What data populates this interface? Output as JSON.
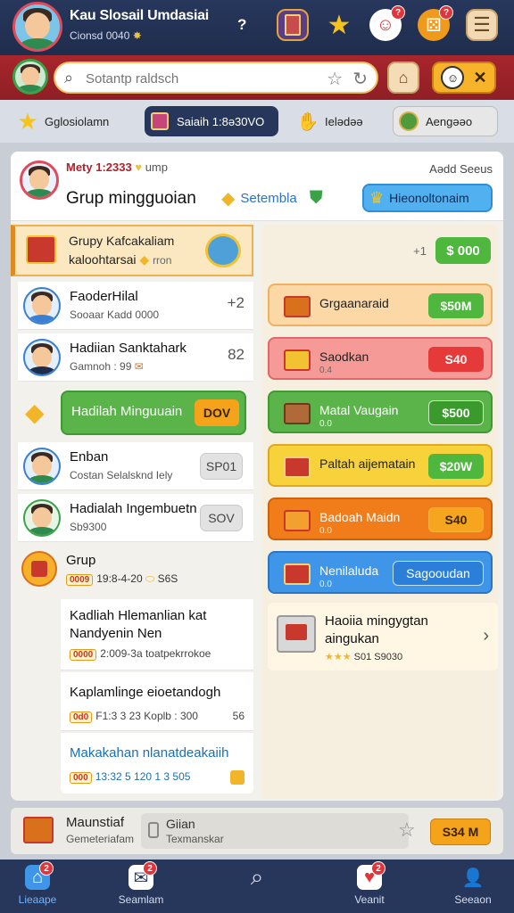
{
  "header": {
    "title": "Kau Slosail Umdasiai",
    "subtitle": "Cionsd 0040",
    "help_label": "?",
    "badges": {
      "gift": "?",
      "face": "?",
      "dice": "?"
    }
  },
  "search": {
    "placeholder": "Sotantp raldsch"
  },
  "categories": [
    {
      "label": "Gglosiolamn",
      "icon": "star-icon"
    },
    {
      "label": "Saiaih 1:8ə30VO",
      "icon": "gift-icon"
    },
    {
      "label": "Ielədəə",
      "icon": "hand-coins-icon"
    },
    {
      "label": "Aengəəo",
      "icon": "badge-icon"
    }
  ],
  "group": {
    "name": "Mety 1:2333",
    "name_suffix": "ump",
    "right_label": "Aədd Seeus",
    "title": "Grup mingguoian",
    "chip": "Setembla",
    "button": "Hieonoltonaim"
  },
  "left_header": {
    "line1": "Grupy Kafcakaliam",
    "line2": "kaloohtarsai",
    "line2_suffix": "rron"
  },
  "friends": [
    {
      "name": "FaoderHilal",
      "status": "Sooaar Kadd 0000",
      "action": "+2"
    },
    {
      "name": "Hadiian Sanktahark",
      "status": "Gamnoh : 99",
      "action": "82"
    }
  ],
  "gift_row": {
    "label": "Hadilah Minguuain",
    "button": "DOV"
  },
  "friends2": [
    {
      "name": "Enban",
      "status": "Costan Selalsknd Iely",
      "pill": "SP01"
    },
    {
      "name": "Hadialah Ingembuetn",
      "status": "Sb9300",
      "pill": "SOV"
    }
  ],
  "grup": {
    "title": "Grup",
    "meta": "19:8-4-20",
    "meta2": "S6S",
    "tag": "0009"
  },
  "subcards": [
    {
      "title": "Kadliah Hlemanlian kat",
      "title2": "Nandyenin Nen",
      "meta": "2:009-3a  toatpekrrokoe",
      "tag": "0000"
    },
    {
      "title": "Kaplamlinge eioetandogh",
      "meta": "F1:3 3 23  Koplb : 300",
      "meta2": "56",
      "tag": "0d0"
    },
    {
      "title": "Makakahan nlanatdeakaiih",
      "meta": "13:32 5 120  1 3  505",
      "tag": "000"
    }
  ],
  "right_top": {
    "label": "+1",
    "price": "$ 000"
  },
  "rewards": [
    {
      "name": "Grgaanaraid",
      "price": "$50M",
      "style": "orange-light"
    },
    {
      "name": "Saodkan",
      "sub": "0.4",
      "price": "S40",
      "style": "red"
    },
    {
      "name": "Matal Vaugain",
      "sub": "0.0",
      "price": "$500",
      "style": "green"
    },
    {
      "name": "Paltah aijematain",
      "price": "$20W",
      "style": "yellow"
    },
    {
      "name": "Badoah Maidn",
      "sub": "0.0",
      "price": "S40",
      "style": "orange"
    },
    {
      "name": "Nenilaluda",
      "sub": "0.0",
      "price": "Sagooudan",
      "style": "blue"
    }
  ],
  "right_card": {
    "title": "Haoiia mingygtan",
    "title2": "aingukan",
    "meta": "S01 S9030"
  },
  "bottom_card": {
    "title": "Maunstiaf",
    "sub": "Gemeteriafam",
    "inbox_title": "Giian",
    "inbox_sub": "Texmanskar",
    "price": "S34 M"
  },
  "nav": [
    {
      "label": "Lieaape",
      "badge": "2"
    },
    {
      "label": "Seamlam",
      "badge": "2"
    },
    {
      "label": ""
    },
    {
      "label": "Veanit",
      "badge": "2"
    },
    {
      "label": "Seeaon"
    }
  ],
  "colors": {
    "header": "#27375c",
    "secondbar": "#a8262c",
    "accent_green": "#4fb73e",
    "accent_orange": "#f5a31a",
    "accent_blue": "#51b1f0"
  }
}
